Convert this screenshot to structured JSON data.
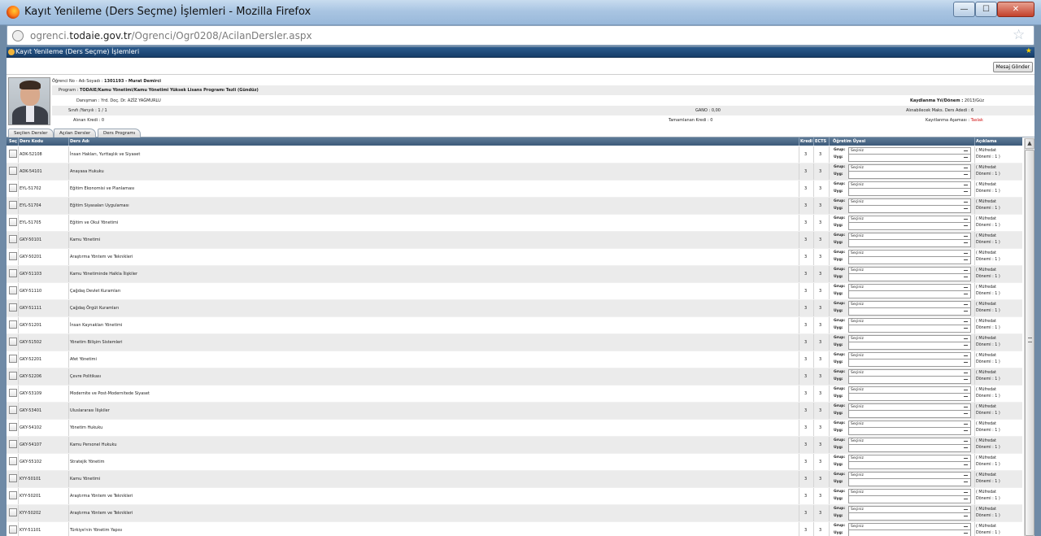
{
  "window": {
    "title": "Kayıt Yenileme (Ders Seçme) İşlemleri - Mozilla Firefox",
    "min_glyph": "—",
    "max_glyph": "☐",
    "close_glyph": "✕"
  },
  "address_bar": {
    "prefix": "ogrenci.",
    "domain": "todaie.gov.tr",
    "path": "/Ogrenci/Ogr0208/AcilanDersler.aspx",
    "star_glyph": "☆"
  },
  "page_header": {
    "title": "Kayıt Yenileme (Ders Seçme) İşlemleri",
    "star_glyph": "★"
  },
  "toolbar": {
    "message_button": "Mesaj Gönder"
  },
  "student": {
    "no_name_label": "Öğrenci No - Adı Soyadı :",
    "no_name_value": "1301193 - Murat Demirci",
    "program_label": "Program :",
    "program_value": "TODAIE/Kamu Yönetimi/Kamu Yönetimi Yüksek Lisans Programı Tezli (Gündüz)",
    "term_label": "Kaydlanma Yıl/Dönem :",
    "term_value": "2013/Güz",
    "advisor_label": "Danışman :",
    "advisor_value": "Yrd. Doç. Dr. AZİZ YAĞMURLU",
    "class_label": "Sınıfı /Yarıyılı :",
    "class_value": "1 / 1",
    "gano_label": "GANO :",
    "gano_value": "0,00",
    "max_courses_label": "Alınabilecek Maks. Ders Adedi :",
    "max_courses_value": "6",
    "taken_credit_label": "Alınan Kredi :",
    "taken_credit_value": "0",
    "completed_credit_label": "Tamamlanan Kredi :",
    "completed_credit_value": "0",
    "stage_label": "Kayıtlanma Aşaması :",
    "stage_value": "Taslak"
  },
  "tabs": [
    "Seçilen Dersler",
    "Açılan Dersler",
    "Ders Programı"
  ],
  "columns": {
    "sec": "Seç",
    "code": "Ders Kodu",
    "name": "Ders Adı",
    "credit": "Kredi",
    "ects": "ECTS",
    "instructor": "Öğretim Üyesi",
    "note": "Açıklama"
  },
  "group_label": "Grup:",
  "practice_label": "Uyg:",
  "select_placeholder": "Seçiniz",
  "note_line1": "( Müfredat",
  "note_line2": "Dönemi : 1 )",
  "courses": [
    {
      "code": "ADK-52108",
      "name": "İnsan Hakları, Yurttaşlık ve Siyaset",
      "credit": "3",
      "ects": "3"
    },
    {
      "code": "ADK-54101",
      "name": "Anayasa Hukuku",
      "credit": "3",
      "ects": "3"
    },
    {
      "code": "EYL-51702",
      "name": "Eğitim Ekonomisi ve Planlaması",
      "credit": "3",
      "ects": "3"
    },
    {
      "code": "EYL-51704",
      "name": "Eğitim Siyasaları Uygulaması",
      "credit": "3",
      "ects": "3"
    },
    {
      "code": "EYL-51705",
      "name": "Eğitim ve Okul Yönetimi",
      "credit": "3",
      "ects": "3"
    },
    {
      "code": "GKY-50101",
      "name": "Kamu Yönetimi",
      "credit": "3",
      "ects": "3"
    },
    {
      "code": "GKY-50201",
      "name": "Araştırma Yöntem ve Teknikleri",
      "credit": "3",
      "ects": "3"
    },
    {
      "code": "GKY-51103",
      "name": "Kamu Yönetiminde Halkla İlişkiler",
      "credit": "3",
      "ects": "3"
    },
    {
      "code": "GKY-51110",
      "name": "Çağdaş Devlet Kuramları",
      "credit": "3",
      "ects": "3"
    },
    {
      "code": "GKY-51111",
      "name": "Çağdaş Örgüt Kuramları",
      "credit": "3",
      "ects": "3"
    },
    {
      "code": "GKY-51201",
      "name": "İnsan Kaynakları Yönetimi",
      "credit": "3",
      "ects": "3"
    },
    {
      "code": "GKY-51502",
      "name": "Yönetim Bilişim Sistemleri",
      "credit": "3",
      "ects": "3"
    },
    {
      "code": "GKY-52201",
      "name": "Afet Yönetimi",
      "credit": "3",
      "ects": "3"
    },
    {
      "code": "GKY-52206",
      "name": "Çevre Politikası",
      "credit": "3",
      "ects": "3"
    },
    {
      "code": "GKY-53109",
      "name": "Modernite ve Post-Modernitede Siyaset",
      "credit": "3",
      "ects": "3"
    },
    {
      "code": "GKY-53401",
      "name": "Uluslararası İlişkiler",
      "credit": "3",
      "ects": "3"
    },
    {
      "code": "GKY-54102",
      "name": "Yönetim Hukuku",
      "credit": "3",
      "ects": "3"
    },
    {
      "code": "GKY-54107",
      "name": "Kamu Personel Hukuku",
      "credit": "3",
      "ects": "3"
    },
    {
      "code": "GKY-55102",
      "name": "Stratejik Yönetim",
      "credit": "3",
      "ects": "3"
    },
    {
      "code": "KYY-50101",
      "name": "Kamu Yönetimi",
      "credit": "3",
      "ects": "3"
    },
    {
      "code": "KYY-50201",
      "name": "Araştırma Yöntem ve Teknikleri",
      "credit": "3",
      "ects": "3"
    },
    {
      "code": "KYY-50202",
      "name": "Araştırma Yöntem ve Teknikleri",
      "credit": "3",
      "ects": "3"
    },
    {
      "code": "KYY-51101",
      "name": "Türkiye'nin Yönetim Yapısı",
      "credit": "3",
      "ects": "3"
    }
  ],
  "scroll_up_glyph": "▲"
}
